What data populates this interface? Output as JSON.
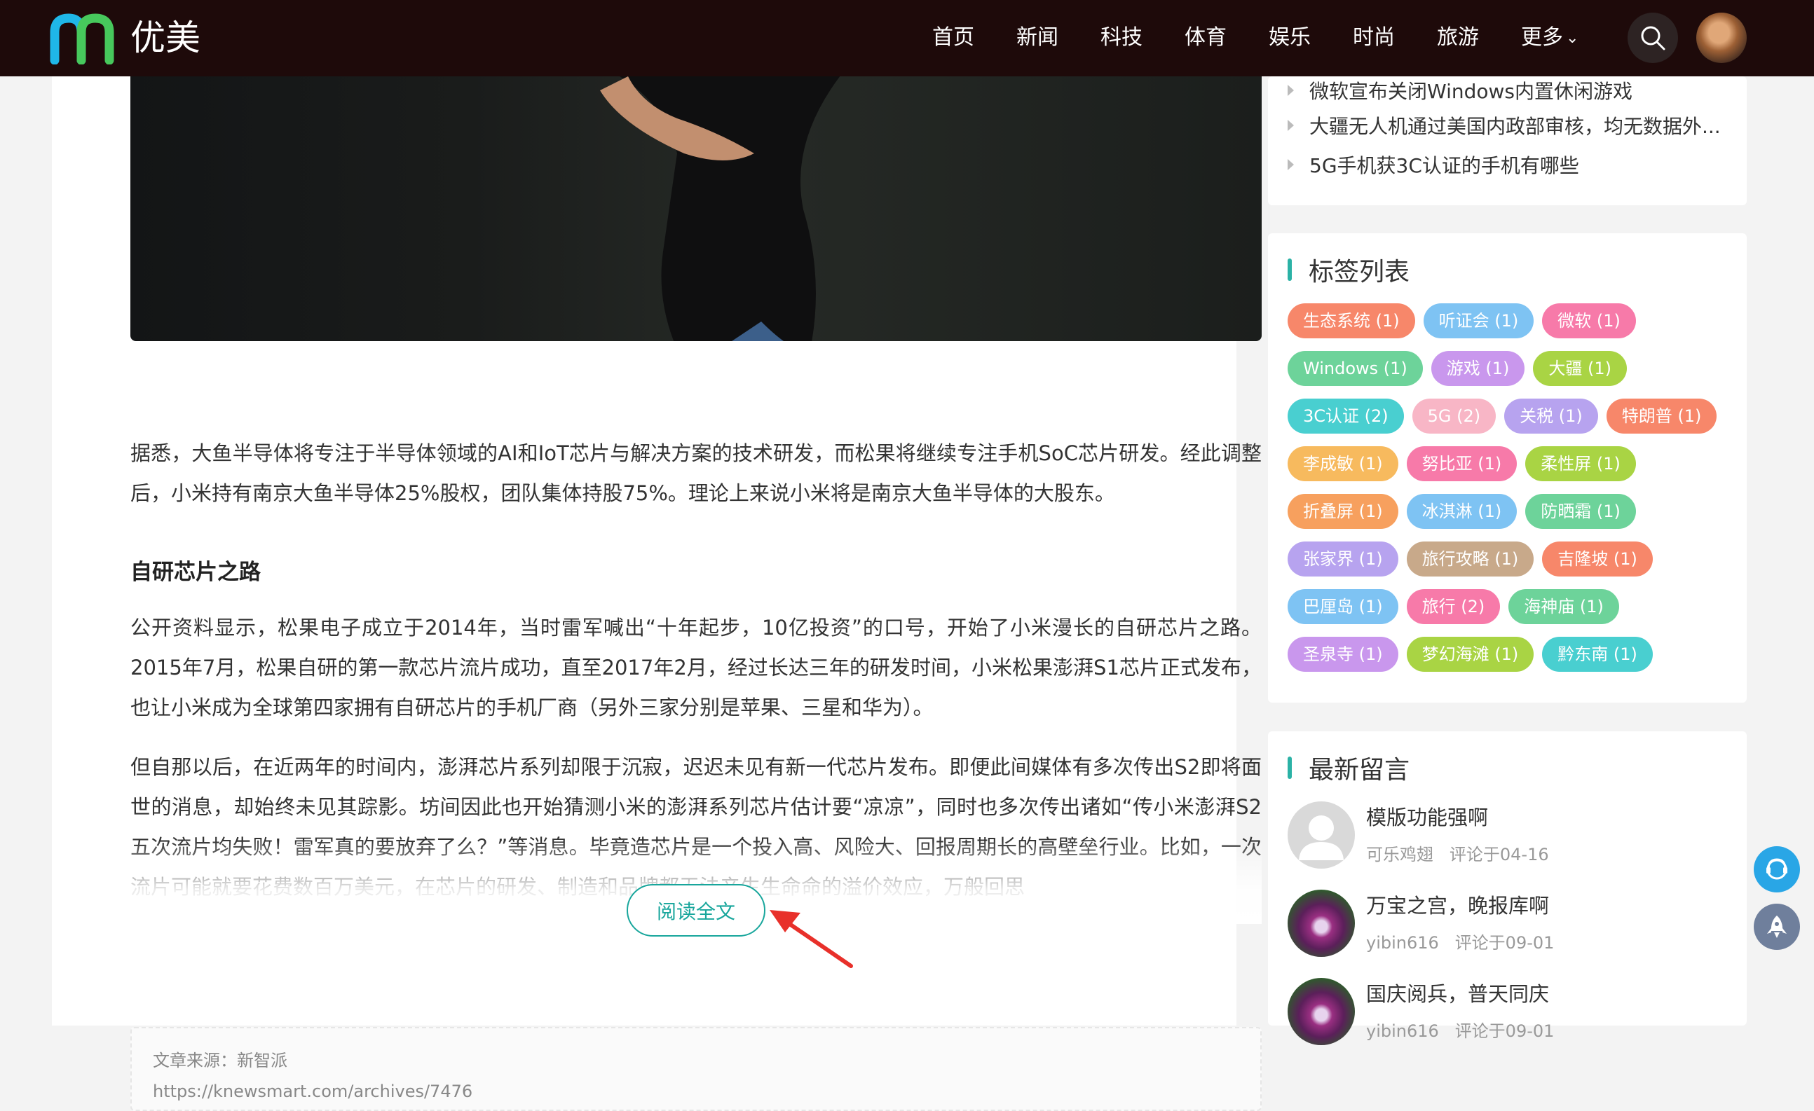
{
  "header": {
    "logo_text": "优美",
    "nav": [
      "首页",
      "新闻",
      "科技",
      "体育",
      "娱乐",
      "时尚",
      "旅游",
      "更多"
    ]
  },
  "article": {
    "p1": "据悉，大鱼半导体将专注于半导体领域的AI和IoT芯片与解决方案的技术研发，而松果将继续专注手机SoC芯片研发。经此调整后，小米持有南京大鱼半导体25%股权，团队集体持股75%。理论上来说小米将是南京大鱼半导体的大股东。",
    "heading": "自研芯片之路",
    "p2": "公开资料显示，松果电子成立于2014年，当时雷军喊出“十年起步，10亿投资”的口号，开始了小米漫长的自研芯片之路。2015年7月，松果自研的第一款芯片流片成功，直至2017年2月，经过长达三年的研发时间，小米松果澎湃S1芯片正式发布，也让小米成为全球第四家拥有自研芯片的手机厂商（另外三家分别是苹果、三星和华为）。",
    "p3": "但自那以后，在近两年的时间内，澎湃芯片系列却限于沉寂，迟迟未见有新一代芯片发布。即便此间媒体有多次传出S2即将面世的消息，却始终未见其踪影。坊间因此也开始猜测小米的澎湃系列芯片估计要“凉凉”，同时也多次传出诸如“传小米澎湃S2五次流片均失败！雷军真的要放弃了么？”等消息。毕竟造芯片是一个投入高、风险大、回报周期长的高壁垒行业。比如，一次流片可能就要花费数百万美元，在芯片的研发、制造和品牌都无法产生生命命的溢价效应，万般回思",
    "read_more": "阅读全文",
    "source_label": "文章来源：新智派",
    "source_url": "https://knewsmart.com/archives/7476"
  },
  "sidebar": {
    "hot_items": [
      "微软宣布关闭Windows内置休闲游戏",
      "大疆无人机通过美国内政部审核，均无数据外...",
      "5G手机获3C认证的手机有哪些"
    ],
    "tags_title": "标签列表",
    "tags": [
      {
        "label": "生态系统 (1)",
        "color": "#f7876a"
      },
      {
        "label": "听证会 (1)",
        "color": "#7ec3f3"
      },
      {
        "label": "微软 (1)",
        "color": "#f77aa9"
      },
      {
        "label": "Windows (1)",
        "color": "#6dd39a"
      },
      {
        "label": "游戏 (1)",
        "color": "#c997ed"
      },
      {
        "label": "大疆 (1)",
        "color": "#a9d444"
      },
      {
        "label": "3C认证 (2)",
        "color": "#49cfd0"
      },
      {
        "label": "5G (2)",
        "color": "#f8b6c6"
      },
      {
        "label": "关税 (1)",
        "color": "#b7a3ef"
      },
      {
        "label": "特朗普 (1)",
        "color": "#f7876a"
      },
      {
        "label": "李成敏 (1)",
        "color": "#f7ba5e"
      },
      {
        "label": "努比亚 (1)",
        "color": "#f77aa9"
      },
      {
        "label": "柔性屏 (1)",
        "color": "#a9d444"
      },
      {
        "label": "折叠屏 (1)",
        "color": "#f7a05e"
      },
      {
        "label": "冰淇淋 (1)",
        "color": "#7ec3f3"
      },
      {
        "label": "防晒霜 (1)",
        "color": "#6dd39a"
      },
      {
        "label": "张家界 (1)",
        "color": "#b7a3ef"
      },
      {
        "label": "旅行攻略 (1)",
        "color": "#c8a98a"
      },
      {
        "label": "吉隆坡 (1)",
        "color": "#f7876a"
      },
      {
        "label": "巴厘岛 (1)",
        "color": "#7ec3f3"
      },
      {
        "label": "旅行 (2)",
        "color": "#f77aa9"
      },
      {
        "label": "海神庙 (1)",
        "color": "#6dd39a"
      },
      {
        "label": "圣泉寺 (1)",
        "color": "#c997ed"
      },
      {
        "label": "梦幻海滩 (1)",
        "color": "#a9d444"
      },
      {
        "label": "黔东南 (1)",
        "color": "#49cfd0"
      }
    ],
    "comments_title": "最新留言",
    "comments": [
      {
        "text": "模版功能强啊",
        "user": "可乐鸡翅",
        "time": "评论于04-16",
        "avatar": "default"
      },
      {
        "text": "万宝之宫，晚报库啊",
        "user": "yibin616",
        "time": "评论于09-01",
        "avatar": "tulip"
      },
      {
        "text": "国庆阅兵，普天同庆",
        "user": "yibin616",
        "time": "评论于09-01",
        "avatar": "tulip"
      }
    ]
  }
}
